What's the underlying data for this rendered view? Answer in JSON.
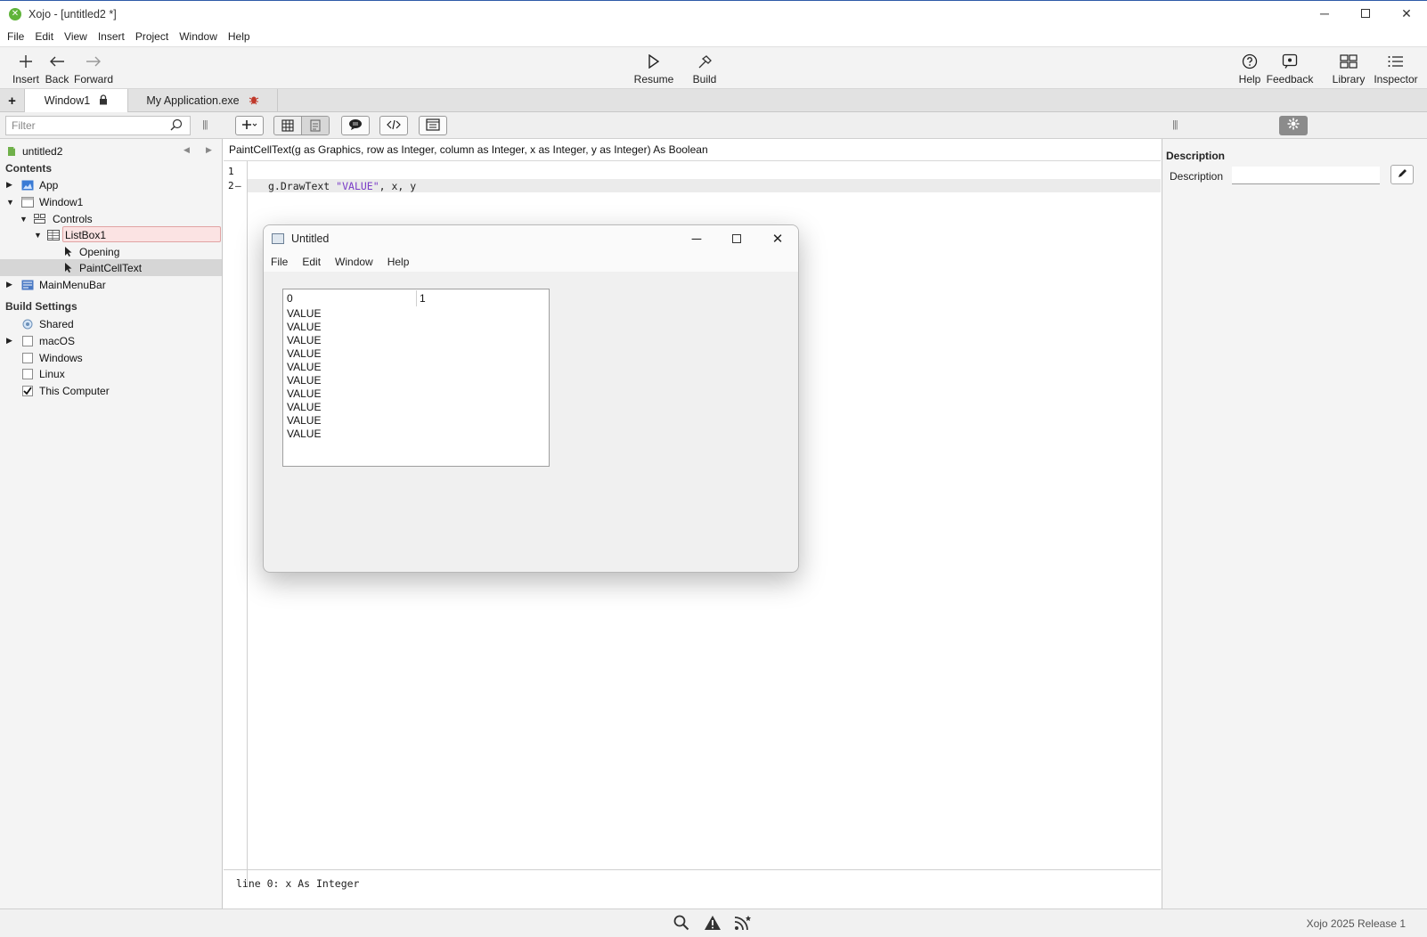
{
  "window": {
    "title": "Xojo - [untitled2 *]",
    "controls": {
      "minimize": "─",
      "close": "✕"
    }
  },
  "menubar": [
    "File",
    "Edit",
    "View",
    "Insert",
    "Project",
    "Window",
    "Help"
  ],
  "toolbar": {
    "insert": "Insert",
    "back": "Back",
    "forward": "Forward",
    "resume": "Resume",
    "build": "Build",
    "help": "Help",
    "feedback": "Feedback",
    "library": "Library",
    "inspector": "Inspector"
  },
  "tabs": [
    {
      "label": "Window1",
      "icon": "lock-icon",
      "active": true
    },
    {
      "label": "My Application.exe",
      "icon": "bug-icon",
      "active": false
    }
  ],
  "filter": {
    "placeholder": "Filter"
  },
  "navigator": {
    "project": "untitled2",
    "contents_header": "Contents",
    "items": {
      "app": "App",
      "window1": "Window1",
      "controls": "Controls",
      "listbox": "ListBox1",
      "opening": "Opening",
      "paintcelltext": "PaintCellText",
      "mainmenubar": "MainMenuBar"
    },
    "build_header": "Build Settings",
    "build": {
      "shared": "Shared",
      "macos": "macOS",
      "windows": "Windows",
      "linux": "Linux",
      "thiscomputer": "This Computer"
    },
    "build_checked": {
      "macos": false,
      "windows": false,
      "linux": false,
      "thiscomputer": true
    }
  },
  "editor": {
    "signature": "PaintCellText(g as Graphics, row as Integer, column as Integer, x as Integer, y as Integer) As Boolean",
    "line_numbers": [
      "1",
      "2"
    ],
    "code_prefix": "g.DrawText ",
    "code_string": "\"VALUE\"",
    "code_suffix": ", x, y",
    "status": "line 0: x As Integer"
  },
  "inspector": {
    "header": "Description",
    "label": "Description",
    "value": ""
  },
  "debug_window": {
    "title": "Untitled",
    "menu": [
      "File",
      "Edit",
      "Window",
      "Help"
    ],
    "listbox": {
      "headers": [
        "0",
        "1"
      ],
      "rows": [
        "VALUE",
        "VALUE",
        "VALUE",
        "VALUE",
        "VALUE",
        "VALUE",
        "VALUE",
        "VALUE",
        "VALUE",
        "VALUE"
      ]
    }
  },
  "statusbar": {
    "version": "Xojo 2025 Release 1"
  },
  "colors": {
    "accent_title_border": "#2f5ba8",
    "selection_row": "#d6d6d6",
    "listbox_highlight": "#fbe3e3",
    "code_string": "#7a3cc7"
  }
}
